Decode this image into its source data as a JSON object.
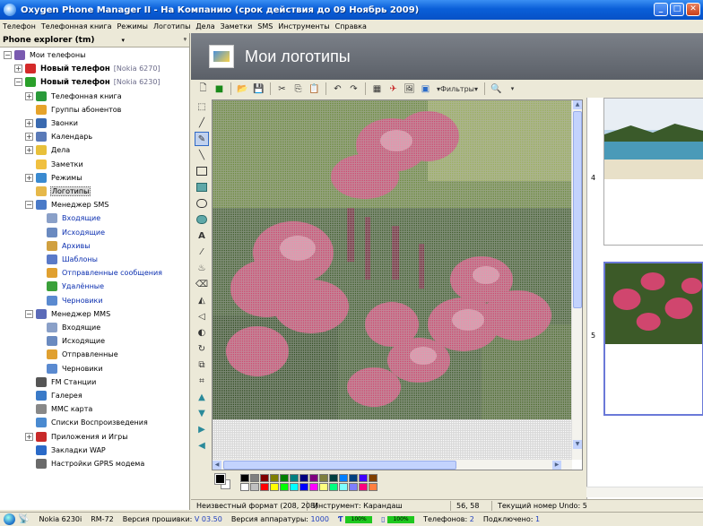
{
  "window": {
    "title": "Oxygen Phone Manager II - На Компанию (срок действия до 09 Ноябрь 2009)",
    "buttons": {
      "minimize": "_",
      "maximize": "□",
      "close": "✕"
    }
  },
  "menu": [
    "Телефон",
    "Телефонная книга",
    "Режимы",
    "Логотипы",
    "Дела",
    "Заметки",
    "SMS",
    "Инструменты",
    "Справка"
  ],
  "left_panel": {
    "title": "Phone explorer (tm)",
    "pin": "ᵠ",
    "dropdown": "▾",
    "tree": [
      {
        "label": "Мои телефоны",
        "expander": "−",
        "icon": "#7a5ab0",
        "style": ""
      },
      {
        "label": "Новый телефон",
        "sub": "[Nokia 6270]",
        "expander": "+",
        "icon": "#d42a2a",
        "style": "bold"
      },
      {
        "label": "Новый телефон",
        "sub": "[Nokia 6230]",
        "expander": "−",
        "icon": "#2aa02a",
        "style": "bold"
      },
      {
        "label": "Телефонная книга",
        "expander": "+",
        "icon": "#2a9a3a",
        "style": ""
      },
      {
        "label": "Группы абонентов",
        "expander": "",
        "icon": "#e6a32a",
        "style": ""
      },
      {
        "label": "Звонки",
        "expander": "+",
        "icon": "#3a6ab0",
        "style": ""
      },
      {
        "label": "Календарь",
        "expander": "+",
        "icon": "#5a7ab8",
        "style": ""
      },
      {
        "label": "Дела",
        "expander": "+",
        "icon": "#e8c03a",
        "style": ""
      },
      {
        "label": "Заметки",
        "expander": "",
        "icon": "#f0c040",
        "style": ""
      },
      {
        "label": "Режимы",
        "expander": "+",
        "icon": "#3a8ad0",
        "style": ""
      },
      {
        "label": "Логотипы",
        "expander": "",
        "icon": "#e6b84a",
        "style": "sel"
      },
      {
        "label": "Менеджер SMS",
        "expander": "−",
        "icon": "#4a7ac8",
        "style": ""
      },
      {
        "label": "Входящие",
        "expander": "",
        "icon": "#8aa0c8",
        "style": "blue"
      },
      {
        "label": "Исходящие",
        "expander": "",
        "icon": "#6a8ac0",
        "style": "blue"
      },
      {
        "label": "Архивы",
        "expander": "",
        "icon": "#d0a040",
        "style": "blue"
      },
      {
        "label": "Шаблоны",
        "expander": "",
        "icon": "#5a7ac8",
        "style": "blue"
      },
      {
        "label": "Отправленные сообщения",
        "expander": "",
        "icon": "#e0a030",
        "style": "blue"
      },
      {
        "label": "Удалённые",
        "expander": "",
        "icon": "#3aa03a",
        "style": "blue"
      },
      {
        "label": "Черновики",
        "expander": "",
        "icon": "#5a8ad0",
        "style": "blue"
      },
      {
        "label": "Менеджер MMS",
        "expander": "−",
        "icon": "#5a6ab8",
        "style": ""
      },
      {
        "label": "Входящие",
        "expander": "",
        "icon": "#8aa0c8",
        "style": ""
      },
      {
        "label": "Исходящие",
        "expander": "",
        "icon": "#6a8ac0",
        "style": ""
      },
      {
        "label": "Отправленные",
        "expander": "",
        "icon": "#e0a030",
        "style": ""
      },
      {
        "label": "Черновики",
        "expander": "",
        "icon": "#5a8ad0",
        "style": ""
      },
      {
        "label": "FM Станции",
        "expander": "",
        "icon": "#555555",
        "style": ""
      },
      {
        "label": "Галерея",
        "expander": "",
        "icon": "#3a7ac8",
        "style": ""
      },
      {
        "label": "MMC карта",
        "expander": "",
        "icon": "#888888",
        "style": ""
      },
      {
        "label": "Списки Воспроизведения",
        "expander": "",
        "icon": "#4a8ad0",
        "style": ""
      },
      {
        "label": "Приложения и Игры",
        "expander": "+",
        "icon": "#c82a2a",
        "style": ""
      },
      {
        "label": "Закладки WAP",
        "expander": "",
        "icon": "#2a6ac8",
        "style": ""
      },
      {
        "label": "Настройки GPRS модема",
        "expander": "",
        "icon": "#6a6a6a",
        "style": ""
      }
    ]
  },
  "main": {
    "title": "Мои логотипы",
    "toolbar_filters": "▾Фильтры▾"
  },
  "palette_colors": [
    "#000000",
    "#7f7f7f",
    "#7f0000",
    "#7f7f00",
    "#007f00",
    "#007f7f",
    "#00007f",
    "#7f007f",
    "#7f7f3f",
    "#003f3f",
    "#007fff",
    "#003f7f",
    "#3f00ff",
    "#7f3f00",
    "#ffffff",
    "#c0c0c0",
    "#ff0000",
    "#ffff00",
    "#00ff00",
    "#00ffff",
    "#0000ff",
    "#ff00ff",
    "#ffff7f",
    "#00ff7f",
    "#7fffff",
    "#7f7fff",
    "#ff007f",
    "#ff7f3f"
  ],
  "thumbnails": [
    {
      "number": "4"
    },
    {
      "number": "5"
    }
  ],
  "status_main": {
    "format": "Неизвестный формат (208, 208)",
    "tool": "Инструмент: Карандаш",
    "coords": "56, 58",
    "undo": "Текущий номер Undo: 5"
  },
  "status_bottom": {
    "model": "Nokia 6230i",
    "rm": "RM-72",
    "firmware_label": "Версия прошивки:",
    "firmware_value": "V 03.50",
    "hardware_label": "Версия аппаратуры:",
    "hardware_value": "1000",
    "signal_percent": "100%",
    "battery_percent": "100%",
    "phones_label": "Телефонов:",
    "phones_value": "2",
    "connected_label": "Подключено:",
    "connected_value": "1"
  }
}
